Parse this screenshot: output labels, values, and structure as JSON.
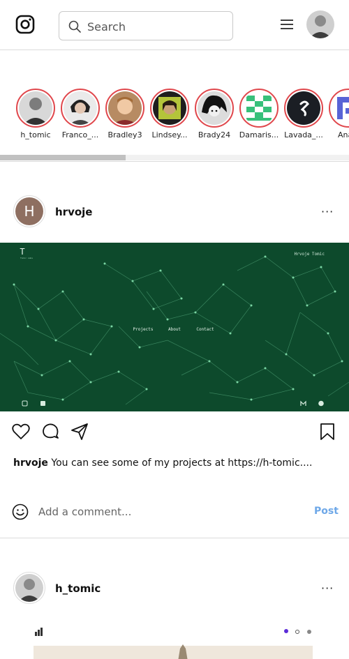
{
  "header": {
    "logo_icon": "instagram-icon",
    "search_placeholder": "Search",
    "search_icon": "search-icon",
    "menu_icon": "hamburger-menu-icon",
    "avatar_icon": "profile-avatar"
  },
  "stories": [
    {
      "username": "h_tomic"
    },
    {
      "username": "Franco_..."
    },
    {
      "username": "Bradley3"
    },
    {
      "username": "Lindsey..."
    },
    {
      "username": "Brady24"
    },
    {
      "username": "Damaris..."
    },
    {
      "username": "Lavada_..."
    },
    {
      "username": "Anais"
    }
  ],
  "posts": [
    {
      "avatar_letter": "H",
      "username": "hrvoje",
      "more": "···",
      "image": {
        "logo_letter": "T",
        "logo_sub": "Tomic Labs",
        "site_title": "Hrvoje Tomic",
        "nav": [
          "Projects",
          "About",
          "Contact"
        ],
        "bg_color": "#0d4a2c"
      },
      "caption_user": "hrvoje",
      "caption_text": "You can see some of my projects at https://h-tomic....",
      "comment_placeholder": "Add a comment...",
      "post_label": "Post"
    },
    {
      "username": "h_tomic",
      "more": "···"
    }
  ],
  "colors": {
    "story_ring": "#e0474c",
    "post_button": "#6ea8e8",
    "border": "#dbdbdb"
  }
}
